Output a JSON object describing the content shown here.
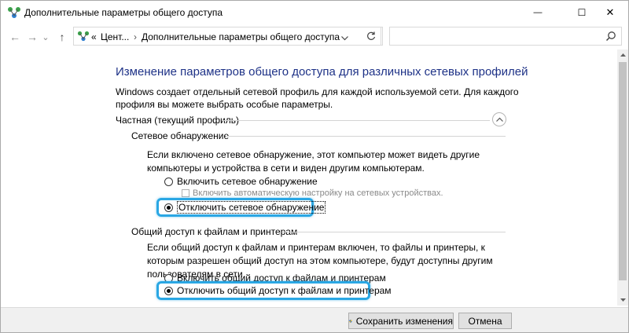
{
  "window": {
    "title": "Дополнительные параметры общего доступа",
    "controls": {
      "minimize": "—",
      "maximize": "☐",
      "close": "✕"
    }
  },
  "nav": {
    "back": "←",
    "forward": "→",
    "recent": "⌄",
    "up": "↑"
  },
  "address": {
    "overflow": "«",
    "segment1": "Цент...",
    "separator": "›",
    "segment2": "Дополнительные параметры общего доступа",
    "search_placeholder": ""
  },
  "content": {
    "heading": "Изменение параметров общего доступа для различных сетевых профилей",
    "description": "Windows создает отдельный сетевой профиль для каждой используемой сети. Для каждого профиля вы можете выбрать особые параметры.",
    "profile_label": "Частная (текущий профиль)",
    "discovery": {
      "label": "Сетевое обнаружение",
      "description": "Если включено сетевое обнаружение, этот компьютер может видеть другие компьютеры и устройства в сети и виден другим компьютерам.",
      "option_on": "Включить сетевое обнаружение",
      "auto_setup": "Включить автоматическую настройку на сетевых устройствах.",
      "option_off": "Отключить сетевое обнаружение",
      "selected": "off"
    },
    "sharing": {
      "label": "Общий доступ к файлам и принтерам",
      "description": "Если общий доступ к файлам и принтерам включен, то файлы и принтеры, к которым разрешен общий доступ на этом компьютере, будут доступны другим пользователям в сети.",
      "option_on": "Включить общий доступ к файлам и принтерам",
      "option_off": "Отключить общий доступ к файлам и принтерам",
      "selected": "off"
    }
  },
  "footer": {
    "save_label": "Сохранить изменения",
    "cancel_label": "Отмена"
  },
  "colors": {
    "heading": "#1e3287",
    "highlight": "#2aa7e4"
  }
}
